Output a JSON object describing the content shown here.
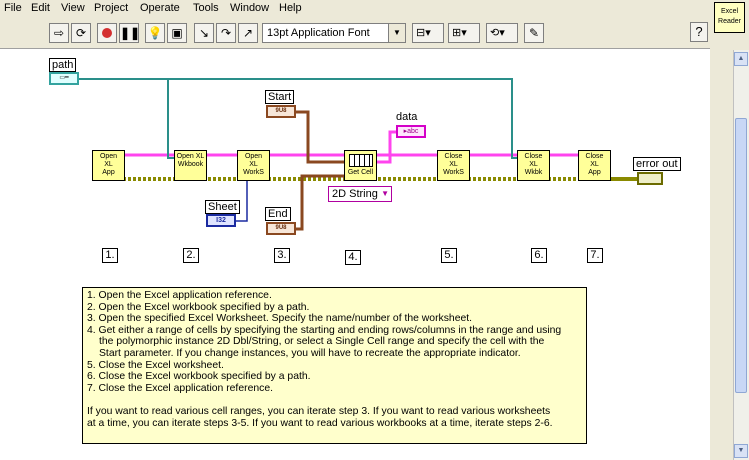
{
  "menu": [
    "File",
    "Edit",
    "View",
    "Project",
    "Operate",
    "Tools",
    "Window",
    "Help"
  ],
  "toolbar": {
    "font": "13pt Application Font",
    "help": "?"
  },
  "vi_icon": {
    "line1": "Excel",
    "line2": "Reader"
  },
  "diagram": {
    "path_label": "path",
    "start_label": "Start",
    "end_label": "End",
    "sheet_label": "Sheet",
    "data_label": "data",
    "error_label": "error out",
    "ring_value": "2D String",
    "u32_text": "9U8",
    "i32_text": "I32",
    "str_text": "abc",
    "nodes": [
      {
        "l1": "Open",
        "l2": "XL",
        "l3": "App"
      },
      {
        "l1": "",
        "l2": "Open XL",
        "l3": "Wkbook"
      },
      {
        "l1": "Open",
        "l2": "XL",
        "l3": "WorkS"
      },
      {
        "l1": "",
        "l2": "",
        "l3": "Get Cell"
      },
      {
        "l1": "Close",
        "l2": "XL",
        "l3": "WorkS"
      },
      {
        "l1": "Close",
        "l2": "XL",
        "l3": "Wkbk"
      },
      {
        "l1": "Close",
        "l2": "XL",
        "l3": "App"
      }
    ],
    "steps": [
      "1.",
      "2.",
      "3.",
      "4.",
      "5.",
      "6.",
      "7."
    ]
  },
  "description": [
    "1. Open the Excel application reference.",
    "2. Open the Excel workbook specified by a path.",
    "3. Open the specified Excel Worksheet. Specify the name/number of the worksheet.",
    "4. Get either a range of cells by specifying the starting and ending rows/columns in the range and using",
    "the polymorphic instance 2D Dbl/String, or select a Single Cell range and specify the cell with the",
    "Start parameter. If you change instances, you will have to recreate the appropriate indicator.",
    "5. Close the Excel worksheet.",
    "6. Close the Excel workbook specified by a path.",
    "7. Close the Excel application reference.",
    "",
    "If you want to read various cell ranges, you can iterate step 3. If you want to read various worksheets",
    "at a time, you can iterate steps 3-5. If you want to read various workbooks at a time, iterate steps 2-6."
  ]
}
